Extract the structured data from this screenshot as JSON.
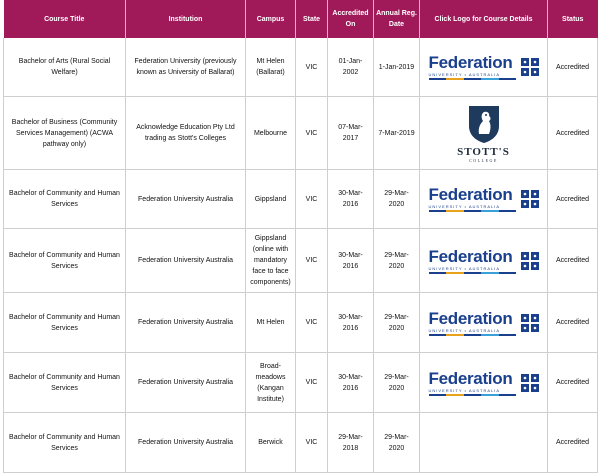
{
  "columns": {
    "course_title": "Course Title",
    "institution": "Institution",
    "campus": "Campus",
    "state": "State",
    "accredited_on": "Accredited On",
    "annual_reg_date": "Annual Reg. Date",
    "logo": "Click Logo for Course Details",
    "status": "Status"
  },
  "rows": [
    {
      "course": "Bachelor of Arts (Rural Social Welfare)",
      "institution": "Federation University (previously known as University of Ballarat)",
      "campus": "Mt Helen (Ballarat)",
      "state": "VIC",
      "accredited_on": "01-Jan-2002",
      "annual_reg_date": "1-Jan-2019",
      "logo": "federation",
      "status": "Accredited"
    },
    {
      "course": "Bachelor of Business (Community Services Management) (ACWA pathway only)",
      "institution": "Acknowledge Education Pty Ltd trading as Stott's Colleges",
      "campus": "Melbourne",
      "state": "VIC",
      "accredited_on": "07-Mar-2017",
      "annual_reg_date": "7-Mar-2019",
      "logo": "stotts",
      "status": "Accredited"
    },
    {
      "course": "Bachelor of Community and Human Services",
      "institution": "Federation University Australia",
      "campus": "Gippsland",
      "state": "VIC",
      "accredited_on": "30-Mar-2016",
      "annual_reg_date": "29-Mar-2020",
      "logo": "federation",
      "status": "Accredited"
    },
    {
      "course": "Bachelor of Community and Human Services",
      "institution": "Federation University Australia",
      "campus": "Gippsland (online with mandatory face to face components)",
      "state": "VIC",
      "accredited_on": "30-Mar-2016",
      "annual_reg_date": "29-Mar-2020",
      "logo": "federation",
      "status": "Accredited"
    },
    {
      "course": "Bachelor of Community and Human Services",
      "institution": "Federation University Australia",
      "campus": "Mt Helen",
      "state": "VIC",
      "accredited_on": "30-Mar-2016",
      "annual_reg_date": "29-Mar-2020",
      "logo": "federation",
      "status": "Accredited"
    },
    {
      "course": "Bachelor of Community and Human Services",
      "institution": "Federation University Australia",
      "campus": "Broad-meadows (Kangan Institute)",
      "state": "VIC",
      "accredited_on": "30-Mar-2016",
      "annual_reg_date": "29-Mar-2020",
      "logo": "federation",
      "status": "Accredited"
    },
    {
      "course": "Bachelor of Community and Human Services",
      "institution": "Federation University Australia",
      "campus": "Berwick",
      "state": "VIC",
      "accredited_on": "29-Mar-2018",
      "annual_reg_date": "29-Mar-2020",
      "logo": "none",
      "status": "Accredited"
    }
  ],
  "logos": {
    "federation": {
      "word": "Federation",
      "sub": "UNIVERSITY • AUSTRALIA",
      "color": "#1a3f8c"
    },
    "stotts": {
      "word": "STOTT'S",
      "sub": "COLLEGE",
      "color": "#1d2a3a"
    }
  },
  "colors": {
    "header_bg": "#a01a5a",
    "header_text": "#ffffff"
  }
}
